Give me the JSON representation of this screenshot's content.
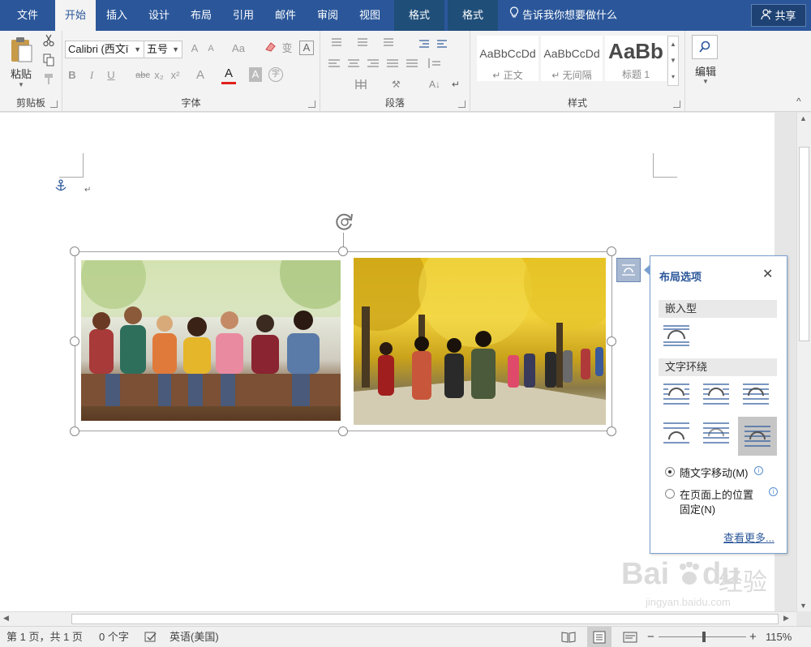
{
  "tabs": [
    "文件",
    "开始",
    "插入",
    "设计",
    "布局",
    "引用",
    "邮件",
    "审阅",
    "视图",
    "格式",
    "格式"
  ],
  "tell_me": "告诉我你想要做什么",
  "share": "共享",
  "ribbon": {
    "clipboard": {
      "paste": "粘贴",
      "label": "剪贴板"
    },
    "font": {
      "font_name": "Calibri (西文ī",
      "font_size": "五号",
      "grow": "A",
      "shrink": "A",
      "change_case": "Aa",
      "phonetic": "变",
      "char_border": "A",
      "bold": "B",
      "italic": "I",
      "underline": "U",
      "strike": "abc",
      "subscript": "x₂",
      "superscript": "x²",
      "text_effect": "A",
      "font_color": "A",
      "char_shade": "A",
      "enclose": "字",
      "label": "字体",
      "font_color_hex": "#e0201c"
    },
    "paragraph": {
      "label": "段落"
    },
    "styles": {
      "items": [
        {
          "sample": "AaBbCcDd",
          "name": "↵ 正文"
        },
        {
          "sample": "AaBbCcDd",
          "name": "↵ 无间隔"
        },
        {
          "sample": "AaBb",
          "name": "标题 1"
        }
      ],
      "label": "样式"
    },
    "editing": {
      "label": "编辑"
    }
  },
  "layout_options": {
    "title": "布局选项",
    "inline_header": "嵌入型",
    "wrap_header": "文字环绕",
    "move_with_text": "随文字移动(M)",
    "fix_position_line1": "在页面上的位置",
    "fix_position_line2": "固定(N)",
    "see_more": "查看更多..."
  },
  "status": {
    "page": "第 1 页，共 1 页",
    "words": "0 个字",
    "language": "英语(美国)",
    "zoom": "115%"
  },
  "watermark": {
    "brand": "Bai",
    "brand2": "du",
    "cn": "经验",
    "url": "jingyan.baidu.com"
  },
  "colors": {
    "accent": "#2b579a",
    "context_tab": "#1f4e79"
  }
}
